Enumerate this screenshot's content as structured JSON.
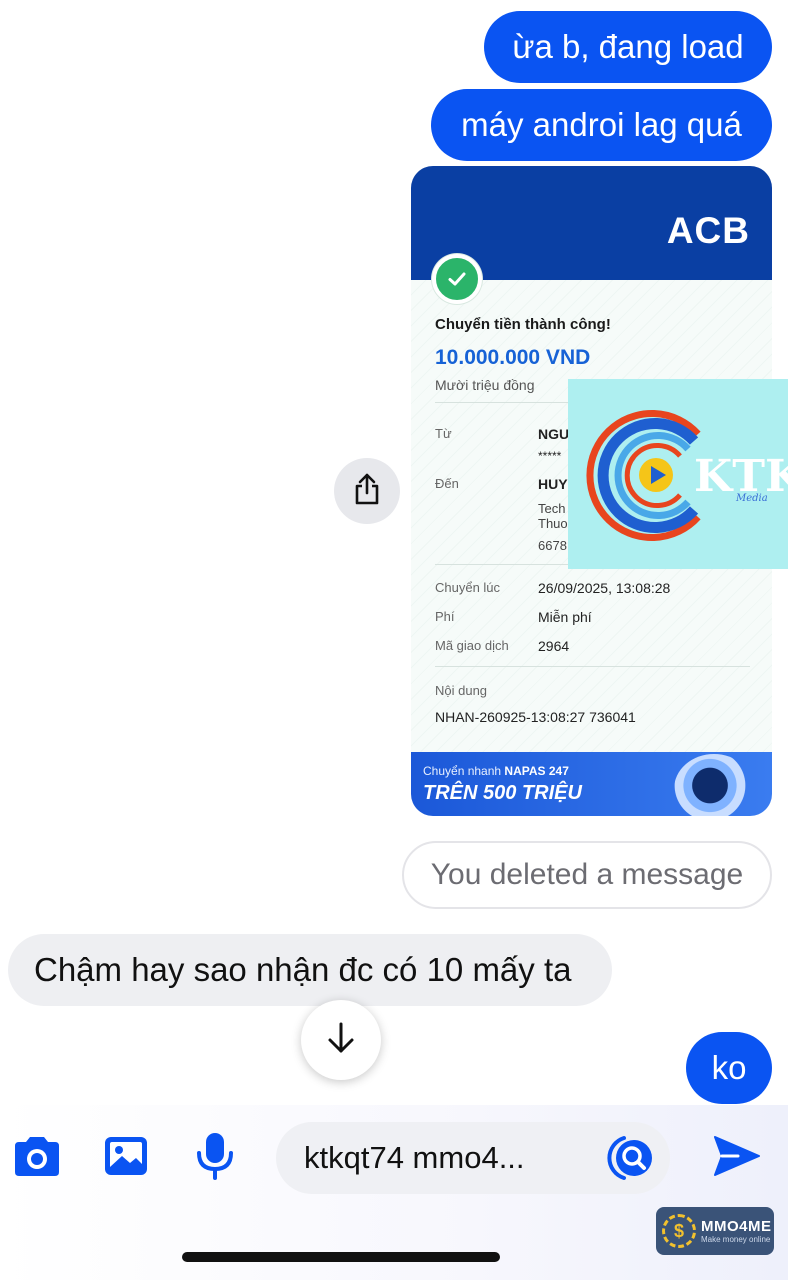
{
  "messages": {
    "out_1": "ừa b, đang load",
    "out_2": "máy androi lag quá",
    "deleted_notice": "You deleted a message",
    "in_1": "Chậm hay sao nhận đc có 10 mấy ta",
    "out_3": "ko"
  },
  "receipt": {
    "bank_logo": "ACB",
    "title": "Chuyển tiền thành công!",
    "amount": "10.000.000 VND",
    "amount_words": "Mười triệu đồng",
    "from_label": "Từ",
    "from_name": "NGU",
    "from_account": "*****",
    "to_label": "Đến",
    "to_name": "HUY",
    "to_bank_1": "Tech",
    "to_bank_2": "Thuo",
    "to_account": "6678",
    "time_label": "Chuyển lúc",
    "time_value": "26/09/2025, 13:08:28",
    "fee_label": "Phí",
    "fee_value": "Miễn phí",
    "txn_label": "Mã giao dịch",
    "txn_value": "2964",
    "content_label": "Nội dung",
    "content_value": "NHAN-260925-13:08:27 736041",
    "banner_small_prefix": "Chuyển nhanh",
    "banner_small_bold": "NAPAS 247",
    "banner_big": "TRÊN 500 TRIỆU"
  },
  "watermark": {
    "brand": "KTK",
    "tagline": "Media"
  },
  "composer": {
    "input_value": "ktkqt74 mmo4..."
  },
  "badge": {
    "name": "MMO4ME",
    "tagline": "Make money online",
    "coin_symbol": "$"
  },
  "colors": {
    "outgoing_bubble": "#0a54f2",
    "incoming_bubble": "#eeeff2",
    "acb_blue": "#0a3fa3",
    "success_green": "#2bb46a",
    "icon_blue": "#0a54f2"
  },
  "icons": {
    "share": "share-icon",
    "scroll_down": "arrow-down-icon",
    "camera": "camera-icon",
    "gallery": "image-icon",
    "voice": "microphone-icon",
    "lens": "search-icon",
    "send": "send-icon"
  }
}
